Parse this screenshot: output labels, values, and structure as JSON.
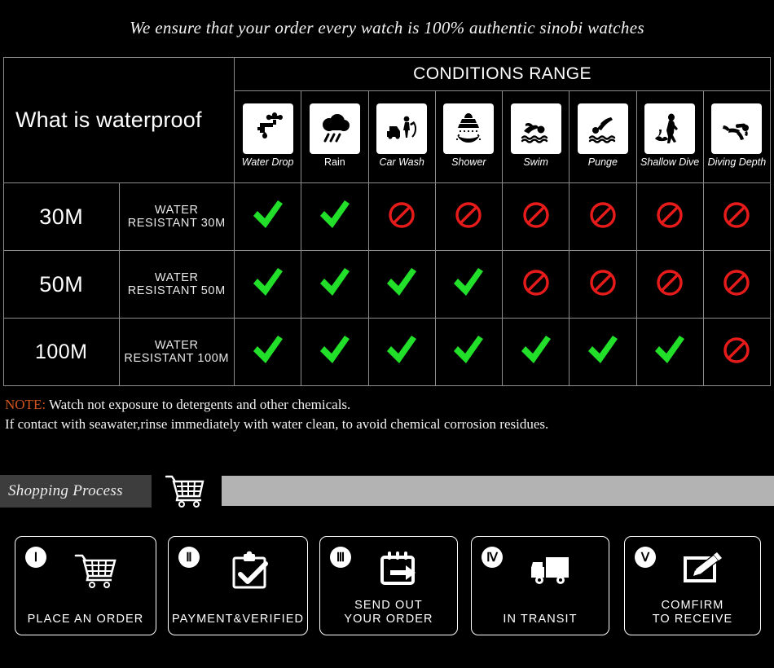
{
  "headline": "We ensure that your order every watch is 100% authentic sinobi watches",
  "table": {
    "corner_title": "What is waterproof",
    "conditions_header": "CONDITIONS RANGE",
    "columns": [
      {
        "label": "Water Drop",
        "icon": "faucet-water-drop-icon",
        "italic": true
      },
      {
        "label": "Rain",
        "icon": "rain-cloud-icon",
        "italic": false
      },
      {
        "label": "Car Wash",
        "icon": "car-wash-icon",
        "italic": true
      },
      {
        "label": "Shower",
        "icon": "shower-icon",
        "italic": true
      },
      {
        "label": "Swim",
        "icon": "swimmer-icon",
        "italic": true
      },
      {
        "label": "Punge",
        "icon": "plunge-dive-icon",
        "italic": true
      },
      {
        "label": "Shallow Dive",
        "icon": "shallow-dive-icon",
        "italic": true
      },
      {
        "label": "Diving Depth",
        "icon": "diving-depth-icon",
        "italic": true
      }
    ],
    "rows": [
      {
        "depth": "30M",
        "description": "WATER RESISTANT  30M",
        "marks": [
          "yes",
          "yes",
          "no",
          "no",
          "no",
          "no",
          "no",
          "no"
        ]
      },
      {
        "depth": "50M",
        "description": "WATER RESISTANT 50M",
        "marks": [
          "yes",
          "yes",
          "yes",
          "yes",
          "no",
          "no",
          "no",
          "no"
        ]
      },
      {
        "depth": "100M",
        "description": "WATER RESISTANT  100M",
        "marks": [
          "yes",
          "yes",
          "yes",
          "yes",
          "yes",
          "yes",
          "yes",
          "no"
        ]
      }
    ]
  },
  "note": {
    "label": "NOTE:",
    "line1": " Watch not exposure to detergents and other chemicals.",
    "line2": "If contact with seawater,rinse immediately with water clean, to avoid chemical corrosion residues."
  },
  "shopping_process": {
    "title": "Shopping Process",
    "cart_icon": "shopping-cart-icon"
  },
  "steps": [
    {
      "numeral": "Ⅰ",
      "label": "PLACE AN ORDER",
      "icon": "shopping-cart-icon"
    },
    {
      "numeral": "Ⅱ",
      "label": "PAYMENT&VERIFIED",
      "icon": "clipboard-check-icon"
    },
    {
      "numeral": "Ⅲ",
      "label": "SEND OUT\nYOUR ORDER",
      "icon": "calendar-arrow-icon"
    },
    {
      "numeral": "Ⅳ",
      "label": "IN TRANSIT",
      "icon": "delivery-truck-icon"
    },
    {
      "numeral": "Ⅴ",
      "label": "COMFIRM\nTO RECEIVE",
      "icon": "sign-document-icon"
    }
  ],
  "colors": {
    "check_green": "#22e02a",
    "ban_red": "#e81b1b",
    "note_label": "#d2551f",
    "band_dark": "#3d3d3d",
    "band_grey": "#b3b3b3",
    "header_bg": "#17171b"
  }
}
